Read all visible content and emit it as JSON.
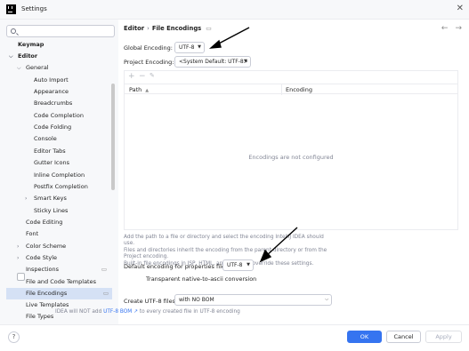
{
  "window": {
    "title": "Settings",
    "close_glyph": "✕"
  },
  "search": {
    "value": "",
    "placeholder": ""
  },
  "sidebar": {
    "items": [
      {
        "label": "Keymap"
      },
      {
        "label": "Editor"
      },
      {
        "label": "General"
      },
      {
        "label": "Auto Import"
      },
      {
        "label": "Appearance"
      },
      {
        "label": "Breadcrumbs"
      },
      {
        "label": "Code Completion"
      },
      {
        "label": "Code Folding"
      },
      {
        "label": "Console"
      },
      {
        "label": "Editor Tabs"
      },
      {
        "label": "Gutter Icons"
      },
      {
        "label": "Inline Completion"
      },
      {
        "label": "Postfix Completion"
      },
      {
        "label": "Smart Keys"
      },
      {
        "label": "Sticky Lines"
      },
      {
        "label": "Code Editing"
      },
      {
        "label": "Font"
      },
      {
        "label": "Color Scheme"
      },
      {
        "label": "Code Style"
      },
      {
        "label": "Inspections"
      },
      {
        "label": "File and Code Templates"
      },
      {
        "label": "File Encodings"
      },
      {
        "label": "Live Templates"
      },
      {
        "label": "File Types"
      }
    ],
    "selected": "File Encodings"
  },
  "breadcrumb": {
    "parent": "Editor",
    "separator": "›",
    "current": "File Encodings"
  },
  "nav": {
    "back": "←",
    "forward": "→"
  },
  "global_encoding": {
    "label": "Global Encoding:",
    "value": "UTF-8"
  },
  "project_encoding": {
    "label": "Project Encoding:",
    "value": "<System Default: UTF-8>"
  },
  "table": {
    "toolbar": {
      "add": "+",
      "remove": "−",
      "edit": "✎"
    },
    "columns": [
      "Path",
      "Encoding"
    ],
    "empty_text": "Encodings are not configured"
  },
  "help_text": {
    "line1": "Add the path to a file or directory and select the encoding IntelliJ IDEA should use.",
    "line2": "Files and directories inherit the encoding from the parent directory or from the Project encoding.",
    "line3": "Built-in file encodings in JSP, HTML, and XML files override these settings."
  },
  "properties": {
    "label": "Default encoding for properties files:",
    "value": "UTF-8",
    "checkbox_label": "Transparent native-to-ascii conversion",
    "checkbox_checked": false
  },
  "bom": {
    "label": "Create UTF-8 files:",
    "value": "with NO BOM",
    "hint_prefix": "IDEA will NOT add",
    "hint_link": "UTF-8 BOM ↗",
    "hint_suffix": "to every created file in UTF-8 encoding"
  },
  "footer": {
    "help": "?",
    "ok": "OK",
    "cancel": "Cancel",
    "apply": "Apply"
  },
  "colors": {
    "accent": "#3574f0",
    "selection": "#d5e1f5",
    "sidebar_bg": "#f7f8fa",
    "annotation": "#000000"
  }
}
